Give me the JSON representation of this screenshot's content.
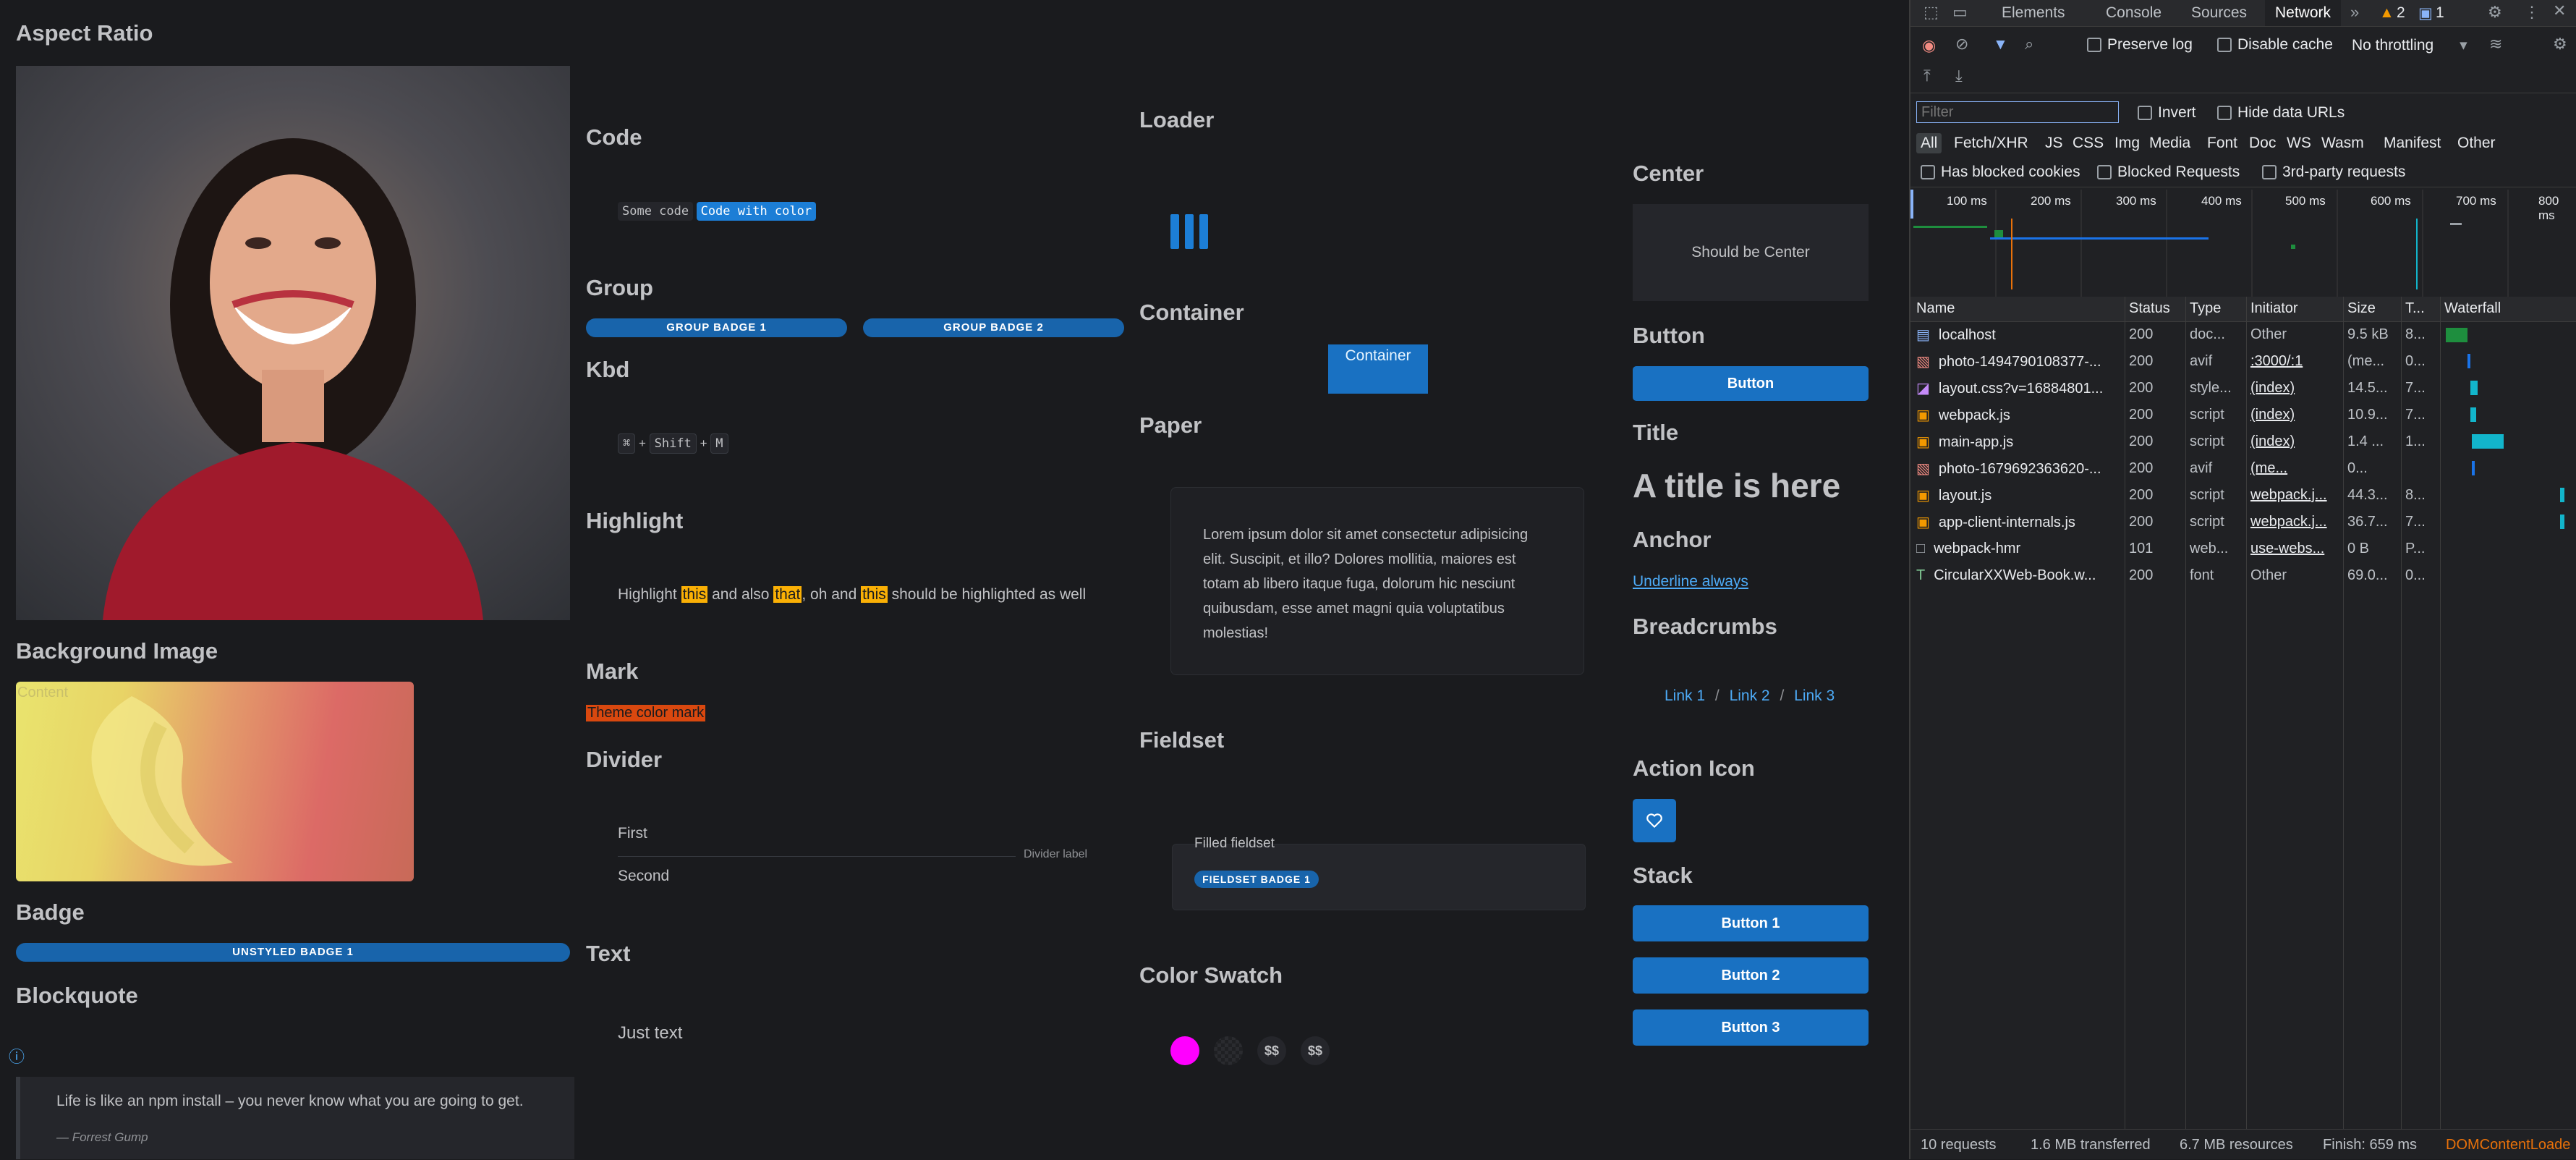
{
  "sections": {
    "aspect_ratio": "Aspect Ratio",
    "background_image": "Background Image",
    "background_content": "Content",
    "badge": "Badge",
    "unstyled_badge": "UNSTYLED BADGE 1",
    "blockquote": "Blockquote",
    "quote_text": "Life is like an npm install – you never know what you are going to get.",
    "quote_cite": "— Forrest Gump",
    "code": "Code",
    "code_plain": "Some code",
    "code_color": "Code with color",
    "group": "Group",
    "group_badge_1": "GROUP BADGE 1",
    "group_badge_2": "GROUP BADGE 2",
    "kbd": "Kbd",
    "kbd_keys": [
      "⌘",
      "+",
      "Shift",
      "+",
      "M"
    ],
    "highlight": "Highlight",
    "highlight_parts": [
      "Highlight ",
      "this",
      " and also ",
      "that",
      ", oh and ",
      "this",
      " should be highlighted as well"
    ],
    "mark": "Mark",
    "mark_text": "Theme color mark",
    "divider": "Divider",
    "divider_first": "First",
    "divider_label": "Divider label",
    "divider_second": "Second",
    "text": "Text",
    "text_value": "Just text",
    "loader": "Loader",
    "container": "Container",
    "container_text": "Container",
    "paper": "Paper",
    "paper_text": "Lorem ipsum dolor sit amet consectetur adipisicing elit. Suscipit, et illo? Dolores mollitia, maiores est totam ab libero itaque fuga, dolorum hic nesciunt quibusdam, esse amet magni quia voluptatibus molestias!",
    "fieldset": "Fieldset",
    "fieldset_legend": "Filled fieldset",
    "fieldset_badge": "FIELDSET BADGE 1",
    "color_swatch": "Color Swatch",
    "swatch_labels": [
      "$$",
      "$$"
    ],
    "center": "Center",
    "center_text": "Should be Center",
    "button": "Button",
    "button_label": "Button",
    "title": "Title",
    "title_text": "A title is here",
    "anchor": "Anchor",
    "anchor_text": "Underline always",
    "breadcrumbs": "Breadcrumbs",
    "crumbs": [
      "Link 1",
      "/",
      "Link 2",
      "/",
      "Link 3"
    ],
    "action_icon": "Action Icon",
    "stack": "Stack",
    "stack_buttons": [
      "Button 1",
      "Button 2",
      "Button 3"
    ]
  },
  "devtools": {
    "tabs": [
      "Elements",
      "Console",
      "Sources",
      "Network"
    ],
    "active_tab": "Network",
    "warnings": "2",
    "messages": "1",
    "preserve_log": "Preserve log",
    "disable_cache": "Disable cache",
    "throttling": "No throttling",
    "filter_placeholder": "Filter",
    "invert": "Invert",
    "hide_data_urls": "Hide data URLs",
    "type_filters": [
      "All",
      "Fetch/XHR",
      "JS",
      "CSS",
      "Img",
      "Media",
      "Font",
      "Doc",
      "WS",
      "Wasm",
      "Manifest",
      "Other"
    ],
    "has_blocked_cookies": "Has blocked cookies",
    "blocked_requests": "Blocked Requests",
    "third_party": "3rd-party requests",
    "timeline_ticks": [
      "100 ms",
      "200 ms",
      "300 ms",
      "400 ms",
      "500 ms",
      "600 ms",
      "700 ms",
      "800 ms"
    ],
    "columns": [
      "Name",
      "Status",
      "Type",
      "Initiator",
      "Size",
      "T...",
      "Waterfall"
    ],
    "rows": [
      {
        "name": "localhost",
        "status": "200",
        "type": "doc...",
        "initiator": "Other",
        "size": "9.5 kB",
        "time": "8...",
        "icon": "document-icon"
      },
      {
        "name": "photo-1494790108377-...",
        "status": "200",
        "type": "avif",
        "initiator": ":3000/:1",
        "size": "(me...",
        "time": "0...",
        "icon": "image-icon"
      },
      {
        "name": "layout.css?v=16884801...",
        "status": "200",
        "type": "style...",
        "initiator": "(index)",
        "size": "14.5...",
        "time": "7...",
        "icon": "stylesheet-icon"
      },
      {
        "name": "webpack.js",
        "status": "200",
        "type": "script",
        "initiator": "(index)",
        "size": "10.9...",
        "time": "7...",
        "icon": "script-icon"
      },
      {
        "name": "main-app.js",
        "status": "200",
        "type": "script",
        "initiator": "(index)",
        "size": "1.4 ...",
        "time": "1...",
        "icon": "script-icon"
      },
      {
        "name": "photo-1679692363620-...",
        "status": "200",
        "type": "avif",
        "initiator": "(me...",
        "size": "0...",
        "time": "",
        "icon": "image-icon"
      },
      {
        "name": "layout.js",
        "status": "200",
        "type": "script",
        "initiator": "webpack.j...",
        "size": "44.3...",
        "time": "8...",
        "icon": "script-icon"
      },
      {
        "name": "app-client-internals.js",
        "status": "200",
        "type": "script",
        "initiator": "webpack.j...",
        "size": "36.7...",
        "time": "7...",
        "icon": "script-icon"
      },
      {
        "name": "webpack-hmr",
        "status": "101",
        "type": "web...",
        "initiator": "use-webs...",
        "size": "0 B",
        "time": "P...",
        "icon": "websocket-icon"
      },
      {
        "name": "CircularXXWeb-Book.w...",
        "status": "200",
        "type": "font",
        "initiator": "Other",
        "size": "69.0...",
        "time": "0...",
        "icon": "font-icon"
      }
    ],
    "footer": [
      "10 requests",
      "1.6 MB transferred",
      "6.7 MB resources",
      "Finish: 659 ms",
      "DOMContentLoade"
    ]
  }
}
